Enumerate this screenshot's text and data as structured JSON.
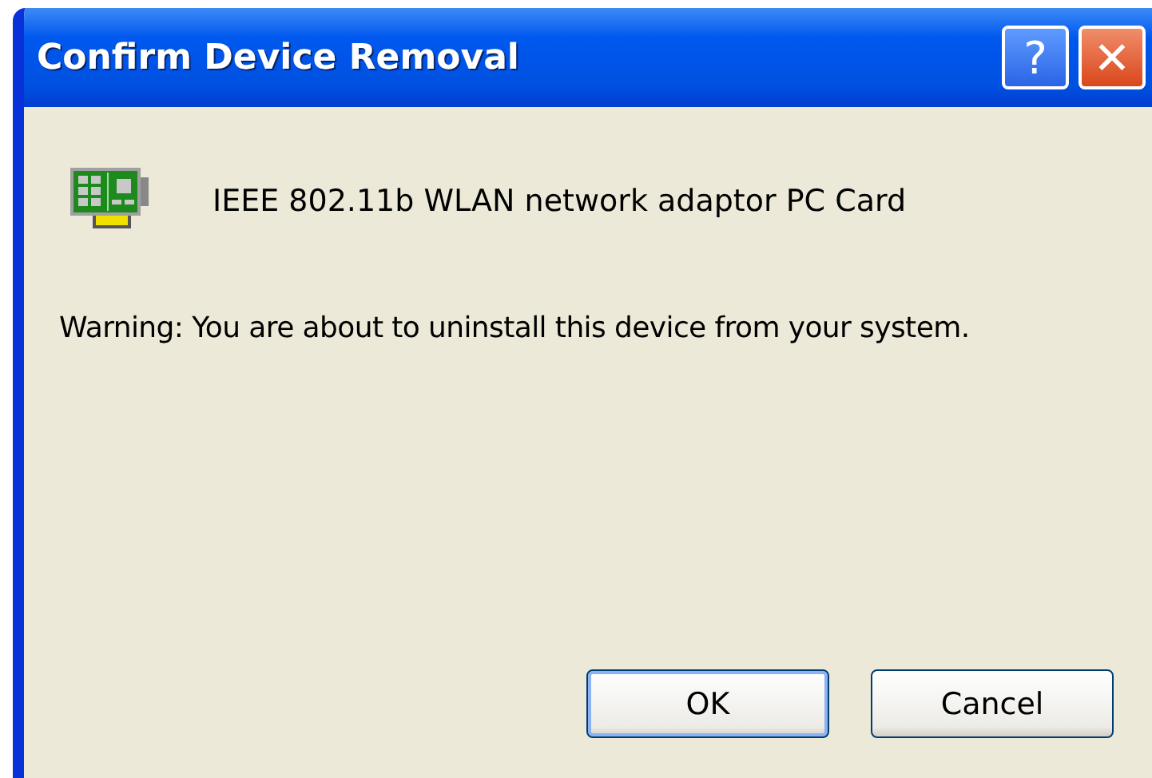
{
  "window": {
    "title": "Confirm Device Removal",
    "help_button": "?",
    "close_button": "✕"
  },
  "device": {
    "name": "IEEE 802.11b WLAN network adaptor PC Card"
  },
  "warning": "Warning: You are about to uninstall this device from your system.",
  "buttons": [
    {
      "label": "OK",
      "default": true
    },
    {
      "label": "Cancel",
      "default": false
    }
  ]
}
